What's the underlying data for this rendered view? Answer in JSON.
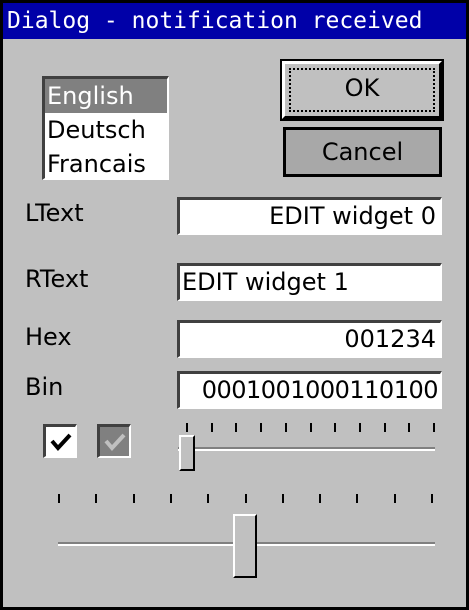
{
  "window": {
    "title": "Dialog - notification received"
  },
  "listbox": {
    "items": [
      "English",
      "Deutsch",
      "Francais"
    ],
    "selected": "English"
  },
  "buttons": {
    "ok_label": "OK",
    "cancel_label": "Cancel"
  },
  "fields": {
    "ltext_label": "LText",
    "ltext_value": "EDIT widget 0",
    "rtext_label": "RText",
    "rtext_value": "EDIT widget 1",
    "hex_label": "Hex",
    "hex_value": "001234",
    "bin_label": "Bin",
    "bin_value": "0001001000110100"
  },
  "checkboxes": [
    {
      "checked": true,
      "enabled": true
    },
    {
      "checked": true,
      "enabled": false
    }
  ],
  "sliders": {
    "upper": {
      "ticks": 11,
      "position_fraction": 0.0
    },
    "lower": {
      "ticks": 11,
      "position_fraction": 0.5
    }
  },
  "colors": {
    "titlebar": "#0000a8",
    "face": "#c0c0c0",
    "selection": "#808080"
  }
}
